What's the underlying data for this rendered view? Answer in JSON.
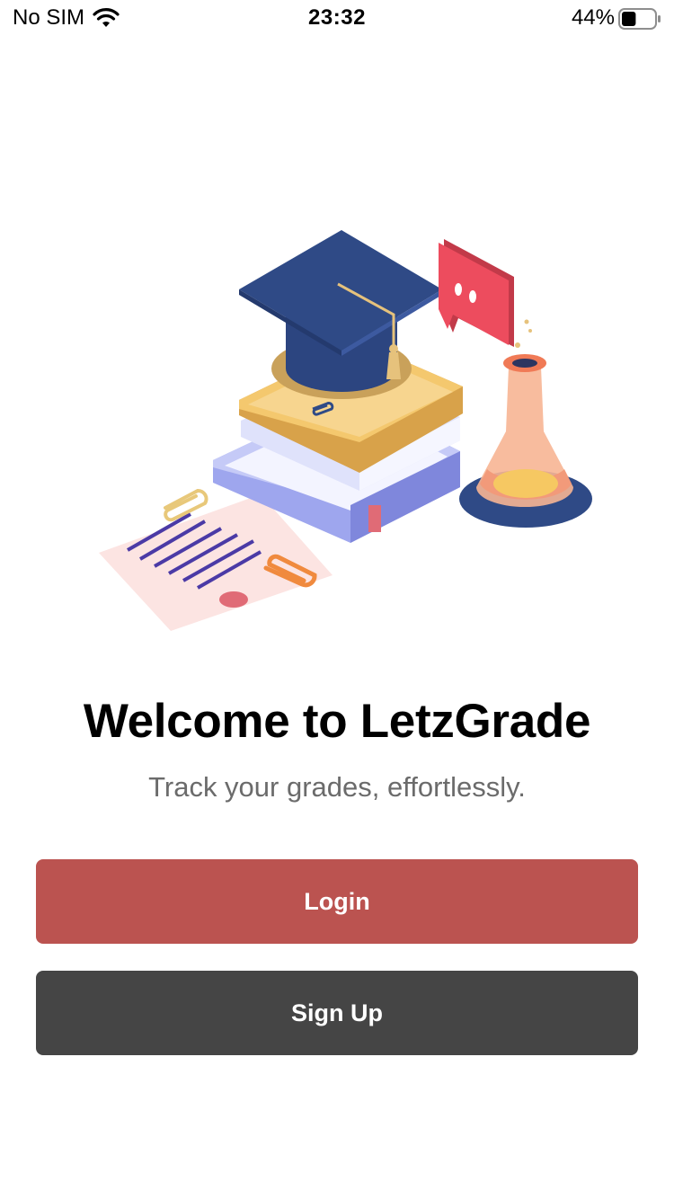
{
  "status_bar": {
    "carrier": "No SIM",
    "time": "23:32",
    "battery_percent": "44%",
    "battery_level": 0.44
  },
  "welcome": {
    "title": "Welcome to LetzGrade",
    "subtitle": "Track your grades, effortlessly."
  },
  "actions": {
    "login_label": "Login",
    "signup_label": "Sign Up"
  },
  "colors": {
    "login_button": "#bb5350",
    "signup_button": "#454545",
    "subtitle_text": "#6b6b6b"
  },
  "icons": {
    "wifi": "wifi-icon",
    "battery": "battery-icon",
    "hero": "education-illustration"
  }
}
